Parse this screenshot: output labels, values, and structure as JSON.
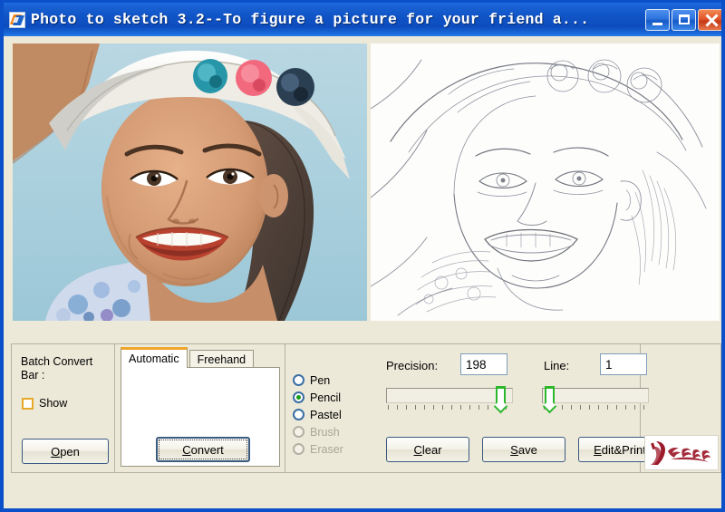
{
  "window": {
    "title": "Photo to sketch 3.2--To figure a picture for your friend a...",
    "app_icon": "app-logo-icon",
    "minimize_label": "_",
    "maximize_label": "□",
    "close_label": "✕",
    "title_bar_color": "#0d4cbe",
    "border_color": "#0b50c8",
    "panel_color": "#ece9d8"
  },
  "workspace": {
    "photo_pane": {
      "name": "source photo preview",
      "alt": "Smiling young woman wearing a white sun hat with teal, pink and navy fabric flowers, light blue studio background",
      "background_color": "#a9ccd8"
    },
    "sketch_pane": {
      "name": "converted sketch preview",
      "alt": "Pencil sketch line drawing of the same portrait",
      "background_color": "#fbfbfa"
    }
  },
  "batch": {
    "label": "Batch Convert Bar :",
    "show_label": "Show",
    "show_checked": false,
    "open_button": {
      "accel": "O",
      "rest": "pen"
    }
  },
  "tabs": {
    "items": [
      {
        "label": "Automatic",
        "active": true
      },
      {
        "label": "Freehand",
        "active": false
      }
    ],
    "active_accent_color": "#f0a52a",
    "convert_button": {
      "accel": "C",
      "rest": "onvert"
    }
  },
  "tools": {
    "options": [
      {
        "label": "Pen",
        "selected": false,
        "enabled": true
      },
      {
        "label": "Pencil",
        "selected": true,
        "enabled": true
      },
      {
        "label": "Pastel",
        "selected": false,
        "enabled": true
      },
      {
        "label": "Brush",
        "selected": false,
        "enabled": false
      },
      {
        "label": "Eraser",
        "selected": false,
        "enabled": false
      }
    ],
    "selected_dot_color": "#199a19"
  },
  "params": {
    "precision": {
      "label": "Precision:",
      "value": "198",
      "slider_percent": 94,
      "min": 0,
      "max": 210
    },
    "line": {
      "label": "Line:",
      "value": "1",
      "slider_percent": 3,
      "min": 0,
      "max": 30
    },
    "slider_thumb_color": "#2cb72c"
  },
  "actions": {
    "clear_button": {
      "accel": "C",
      "rest": "lear"
    },
    "save_button": {
      "accel": "S",
      "rest": "ave"
    },
    "edit_print_button": {
      "accel": "E",
      "rest": "dit&Print"
    }
  },
  "branding": {
    "logo_name": "vendor-script-logo",
    "logo_color": "#9c1a2a"
  }
}
